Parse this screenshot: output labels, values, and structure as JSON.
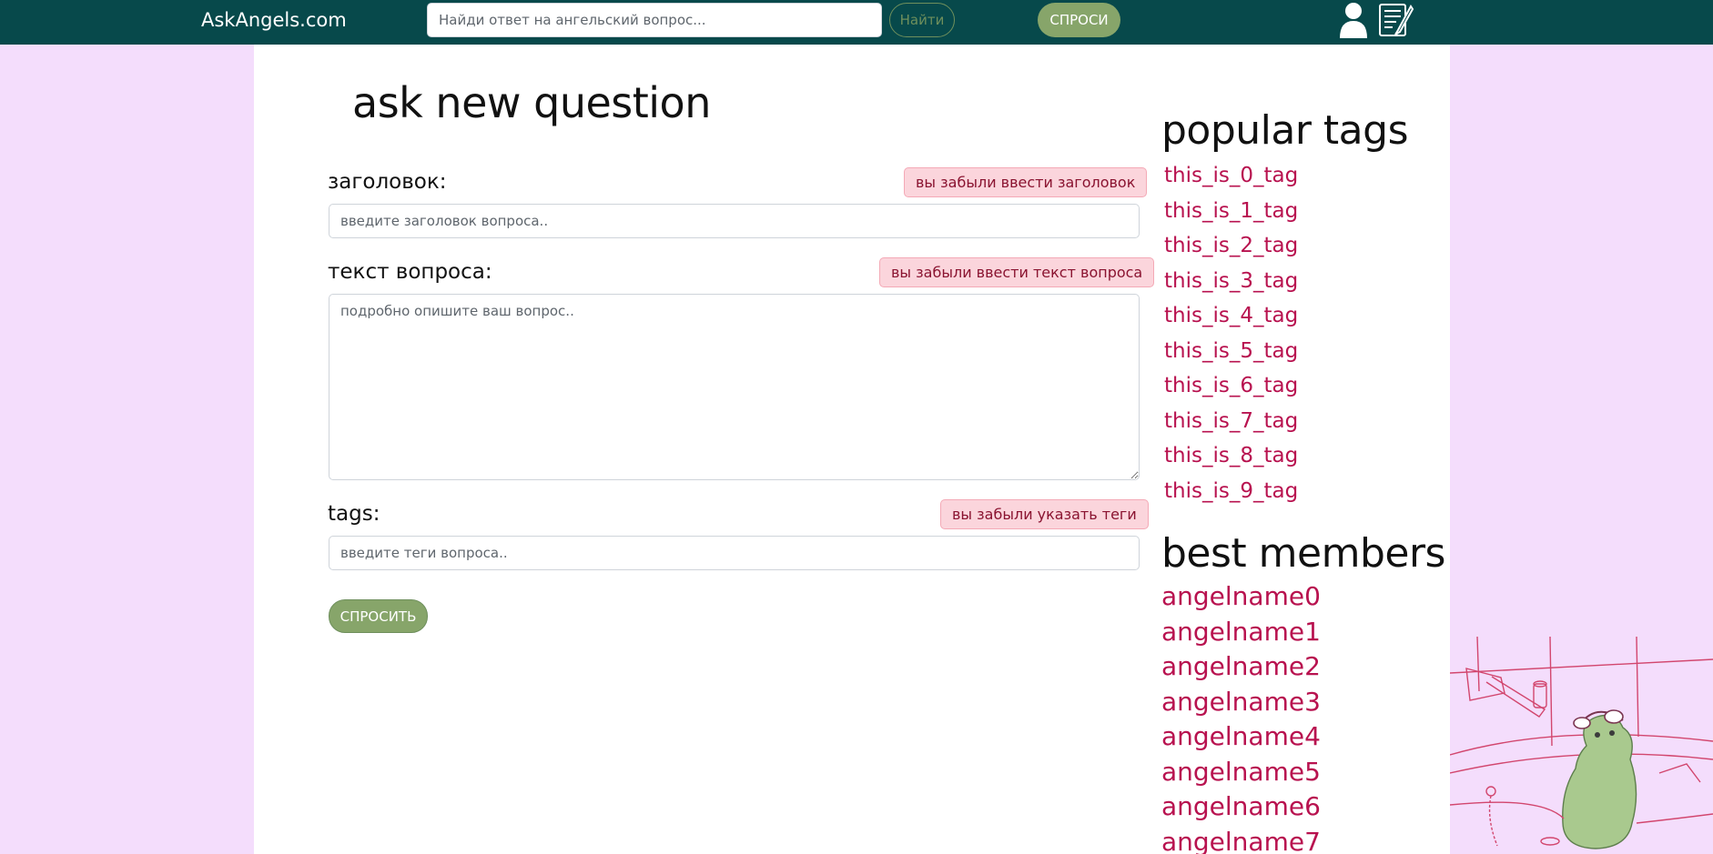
{
  "navbar": {
    "brand": "AskAngels.com",
    "search_placeholder": "Найди ответ на ангельский вопрос...",
    "find_label": "Найти",
    "ask_label": "СПРОСИ",
    "user_icon": "user-icon",
    "notes_icon": "notes-icon"
  },
  "main": {
    "title": "ask new question",
    "fields": {
      "title_label": "заголовок:",
      "title_error": "вы забыли ввести заголовок",
      "title_placeholder": "введите заголовок вопроса..",
      "text_label": "текст вопроса:",
      "text_error": "вы забыли ввести текст вопроса",
      "text_placeholder": "подробно опишите ваш вопрос..",
      "tags_label": "tags:",
      "tags_error": "вы забыли указать теги",
      "tags_placeholder": "введите теги вопроса.."
    },
    "submit_label": "СПРОСИТЬ"
  },
  "sidebar": {
    "tags_heading": "popular tags",
    "tags": [
      "this_is_0_tag",
      "this_is_1_tag",
      "this_is_2_tag",
      "this_is_3_tag",
      "this_is_4_tag",
      "this_is_5_tag",
      "this_is_6_tag",
      "this_is_7_tag",
      "this_is_8_tag",
      "this_is_9_tag"
    ],
    "members_heading": "best members",
    "members": [
      "angelname0",
      "angelname1",
      "angelname2",
      "angelname3",
      "angelname4",
      "angelname5",
      "angelname6",
      "angelname7"
    ]
  },
  "colors": {
    "navbar": "#07494b",
    "page_background": "#f4ddfc",
    "accent_green": "#87a56a",
    "link": "#b8124f",
    "error_bg": "#fbd5dc"
  }
}
